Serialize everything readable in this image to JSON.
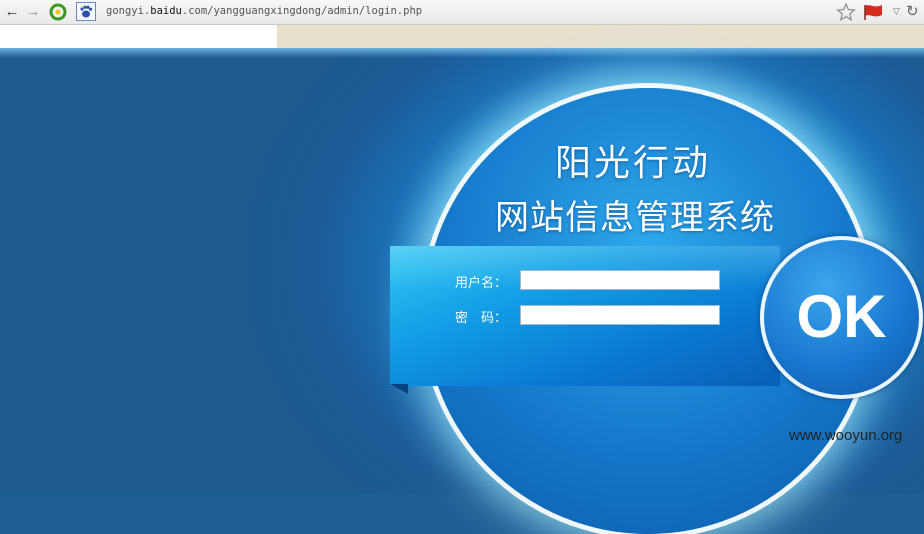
{
  "browser": {
    "url_prefix": "gongyi.",
    "url_domain": "baidu",
    "url_suffix": ".com/yangguangxingdong/admin/login.php",
    "icons": {
      "back": "left-arrow-icon",
      "forward": "right-arrow-icon",
      "reload": "green-circle-icon",
      "favicon": "baidu-paw-icon",
      "bookmark": "star-icon",
      "flag": "flag-icon",
      "dropdown": "triangle-down-icon",
      "refresh": "refresh-icon"
    }
  },
  "login": {
    "title_line1": "阳光行动",
    "title_line2": "网站信息管理系统",
    "username_label": "用户名：",
    "password_label": "密　码：",
    "username_value": "",
    "password_value": "",
    "submit_label": "OK"
  },
  "watermark": "www.wooyun.org",
  "colors": {
    "background": "#1f5f96",
    "panel": "#129ee6",
    "circle": "#1579cc",
    "glow": "#c9f4ff"
  }
}
